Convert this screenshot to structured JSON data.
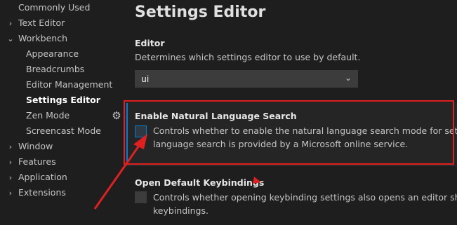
{
  "sidebar": {
    "items": [
      {
        "label": "Commonly Used",
        "chevron": "",
        "indent": 0
      },
      {
        "label": "Text Editor",
        "chevron": "right",
        "indent": 0
      },
      {
        "label": "Workbench",
        "chevron": "down",
        "indent": 0
      },
      {
        "label": "Appearance",
        "chevron": "",
        "indent": 1
      },
      {
        "label": "Breadcrumbs",
        "chevron": "",
        "indent": 1
      },
      {
        "label": "Editor Management",
        "chevron": "",
        "indent": 1
      },
      {
        "label": "Settings Editor",
        "chevron": "",
        "indent": 1,
        "active": true
      },
      {
        "label": "Zen Mode",
        "chevron": "",
        "indent": 1
      },
      {
        "label": "Screencast Mode",
        "chevron": "",
        "indent": 1
      },
      {
        "label": "Window",
        "chevron": "right",
        "indent": 0
      },
      {
        "label": "Features",
        "chevron": "right",
        "indent": 0
      },
      {
        "label": "Application",
        "chevron": "right",
        "indent": 0
      },
      {
        "label": "Extensions",
        "chevron": "right",
        "indent": 0
      }
    ],
    "gear_icon": "gear-icon"
  },
  "main": {
    "page_title": "Settings Editor",
    "editor_setting": {
      "title": "Editor",
      "description": "Determines which settings editor to use by default.",
      "select_value": "ui"
    },
    "nl_search_setting": {
      "title": "Enable Natural Language Search",
      "description_line1": "Controls whether to enable the natural language search mode for settings. The natural",
      "description_line2": "language search is provided by a Microsoft online service.",
      "checked": false
    },
    "keybindings_setting": {
      "title": "Open Default Keybindings",
      "description_line1": "Controls whether opening keybinding settings also opens an editor showing all default",
      "description_line2": "keybindings.",
      "checked": false
    }
  },
  "colors": {
    "background": "#1e1e1e",
    "accent_focus": "#007fd4",
    "annotation_red": "#e02020"
  }
}
